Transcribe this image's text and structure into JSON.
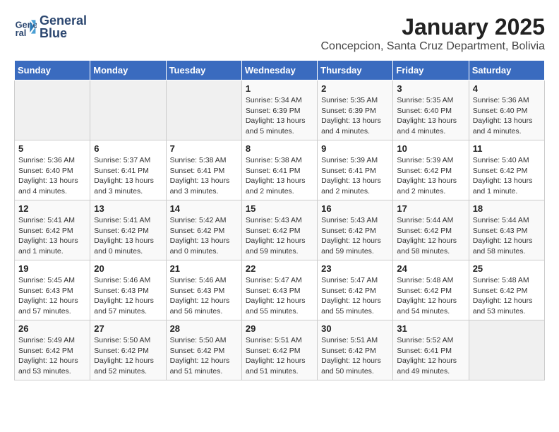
{
  "header": {
    "logo_line1": "General",
    "logo_line2": "Blue",
    "title": "January 2025",
    "subtitle": "Concepcion, Santa Cruz Department, Bolivia"
  },
  "days_of_week": [
    "Sunday",
    "Monday",
    "Tuesday",
    "Wednesday",
    "Thursday",
    "Friday",
    "Saturday"
  ],
  "weeks": [
    [
      {
        "day": "",
        "info": ""
      },
      {
        "day": "",
        "info": ""
      },
      {
        "day": "",
        "info": ""
      },
      {
        "day": "1",
        "info": "Sunrise: 5:34 AM\nSunset: 6:39 PM\nDaylight: 13 hours\nand 5 minutes."
      },
      {
        "day": "2",
        "info": "Sunrise: 5:35 AM\nSunset: 6:39 PM\nDaylight: 13 hours\nand 4 minutes."
      },
      {
        "day": "3",
        "info": "Sunrise: 5:35 AM\nSunset: 6:40 PM\nDaylight: 13 hours\nand 4 minutes."
      },
      {
        "day": "4",
        "info": "Sunrise: 5:36 AM\nSunset: 6:40 PM\nDaylight: 13 hours\nand 4 minutes."
      }
    ],
    [
      {
        "day": "5",
        "info": "Sunrise: 5:36 AM\nSunset: 6:40 PM\nDaylight: 13 hours\nand 4 minutes."
      },
      {
        "day": "6",
        "info": "Sunrise: 5:37 AM\nSunset: 6:41 PM\nDaylight: 13 hours\nand 3 minutes."
      },
      {
        "day": "7",
        "info": "Sunrise: 5:38 AM\nSunset: 6:41 PM\nDaylight: 13 hours\nand 3 minutes."
      },
      {
        "day": "8",
        "info": "Sunrise: 5:38 AM\nSunset: 6:41 PM\nDaylight: 13 hours\nand 2 minutes."
      },
      {
        "day": "9",
        "info": "Sunrise: 5:39 AM\nSunset: 6:41 PM\nDaylight: 13 hours\nand 2 minutes."
      },
      {
        "day": "10",
        "info": "Sunrise: 5:39 AM\nSunset: 6:42 PM\nDaylight: 13 hours\nand 2 minutes."
      },
      {
        "day": "11",
        "info": "Sunrise: 5:40 AM\nSunset: 6:42 PM\nDaylight: 13 hours\nand 1 minute."
      }
    ],
    [
      {
        "day": "12",
        "info": "Sunrise: 5:41 AM\nSunset: 6:42 PM\nDaylight: 13 hours\nand 1 minute."
      },
      {
        "day": "13",
        "info": "Sunrise: 5:41 AM\nSunset: 6:42 PM\nDaylight: 13 hours\nand 0 minutes."
      },
      {
        "day": "14",
        "info": "Sunrise: 5:42 AM\nSunset: 6:42 PM\nDaylight: 13 hours\nand 0 minutes."
      },
      {
        "day": "15",
        "info": "Sunrise: 5:43 AM\nSunset: 6:42 PM\nDaylight: 12 hours\nand 59 minutes."
      },
      {
        "day": "16",
        "info": "Sunrise: 5:43 AM\nSunset: 6:42 PM\nDaylight: 12 hours\nand 59 minutes."
      },
      {
        "day": "17",
        "info": "Sunrise: 5:44 AM\nSunset: 6:42 PM\nDaylight: 12 hours\nand 58 minutes."
      },
      {
        "day": "18",
        "info": "Sunrise: 5:44 AM\nSunset: 6:43 PM\nDaylight: 12 hours\nand 58 minutes."
      }
    ],
    [
      {
        "day": "19",
        "info": "Sunrise: 5:45 AM\nSunset: 6:43 PM\nDaylight: 12 hours\nand 57 minutes."
      },
      {
        "day": "20",
        "info": "Sunrise: 5:46 AM\nSunset: 6:43 PM\nDaylight: 12 hours\nand 57 minutes."
      },
      {
        "day": "21",
        "info": "Sunrise: 5:46 AM\nSunset: 6:43 PM\nDaylight: 12 hours\nand 56 minutes."
      },
      {
        "day": "22",
        "info": "Sunrise: 5:47 AM\nSunset: 6:43 PM\nDaylight: 12 hours\nand 55 minutes."
      },
      {
        "day": "23",
        "info": "Sunrise: 5:47 AM\nSunset: 6:42 PM\nDaylight: 12 hours\nand 55 minutes."
      },
      {
        "day": "24",
        "info": "Sunrise: 5:48 AM\nSunset: 6:42 PM\nDaylight: 12 hours\nand 54 minutes."
      },
      {
        "day": "25",
        "info": "Sunrise: 5:48 AM\nSunset: 6:42 PM\nDaylight: 12 hours\nand 53 minutes."
      }
    ],
    [
      {
        "day": "26",
        "info": "Sunrise: 5:49 AM\nSunset: 6:42 PM\nDaylight: 12 hours\nand 53 minutes."
      },
      {
        "day": "27",
        "info": "Sunrise: 5:50 AM\nSunset: 6:42 PM\nDaylight: 12 hours\nand 52 minutes."
      },
      {
        "day": "28",
        "info": "Sunrise: 5:50 AM\nSunset: 6:42 PM\nDaylight: 12 hours\nand 51 minutes."
      },
      {
        "day": "29",
        "info": "Sunrise: 5:51 AM\nSunset: 6:42 PM\nDaylight: 12 hours\nand 51 minutes."
      },
      {
        "day": "30",
        "info": "Sunrise: 5:51 AM\nSunset: 6:42 PM\nDaylight: 12 hours\nand 50 minutes."
      },
      {
        "day": "31",
        "info": "Sunrise: 5:52 AM\nSunset: 6:41 PM\nDaylight: 12 hours\nand 49 minutes."
      },
      {
        "day": "",
        "info": ""
      }
    ]
  ]
}
